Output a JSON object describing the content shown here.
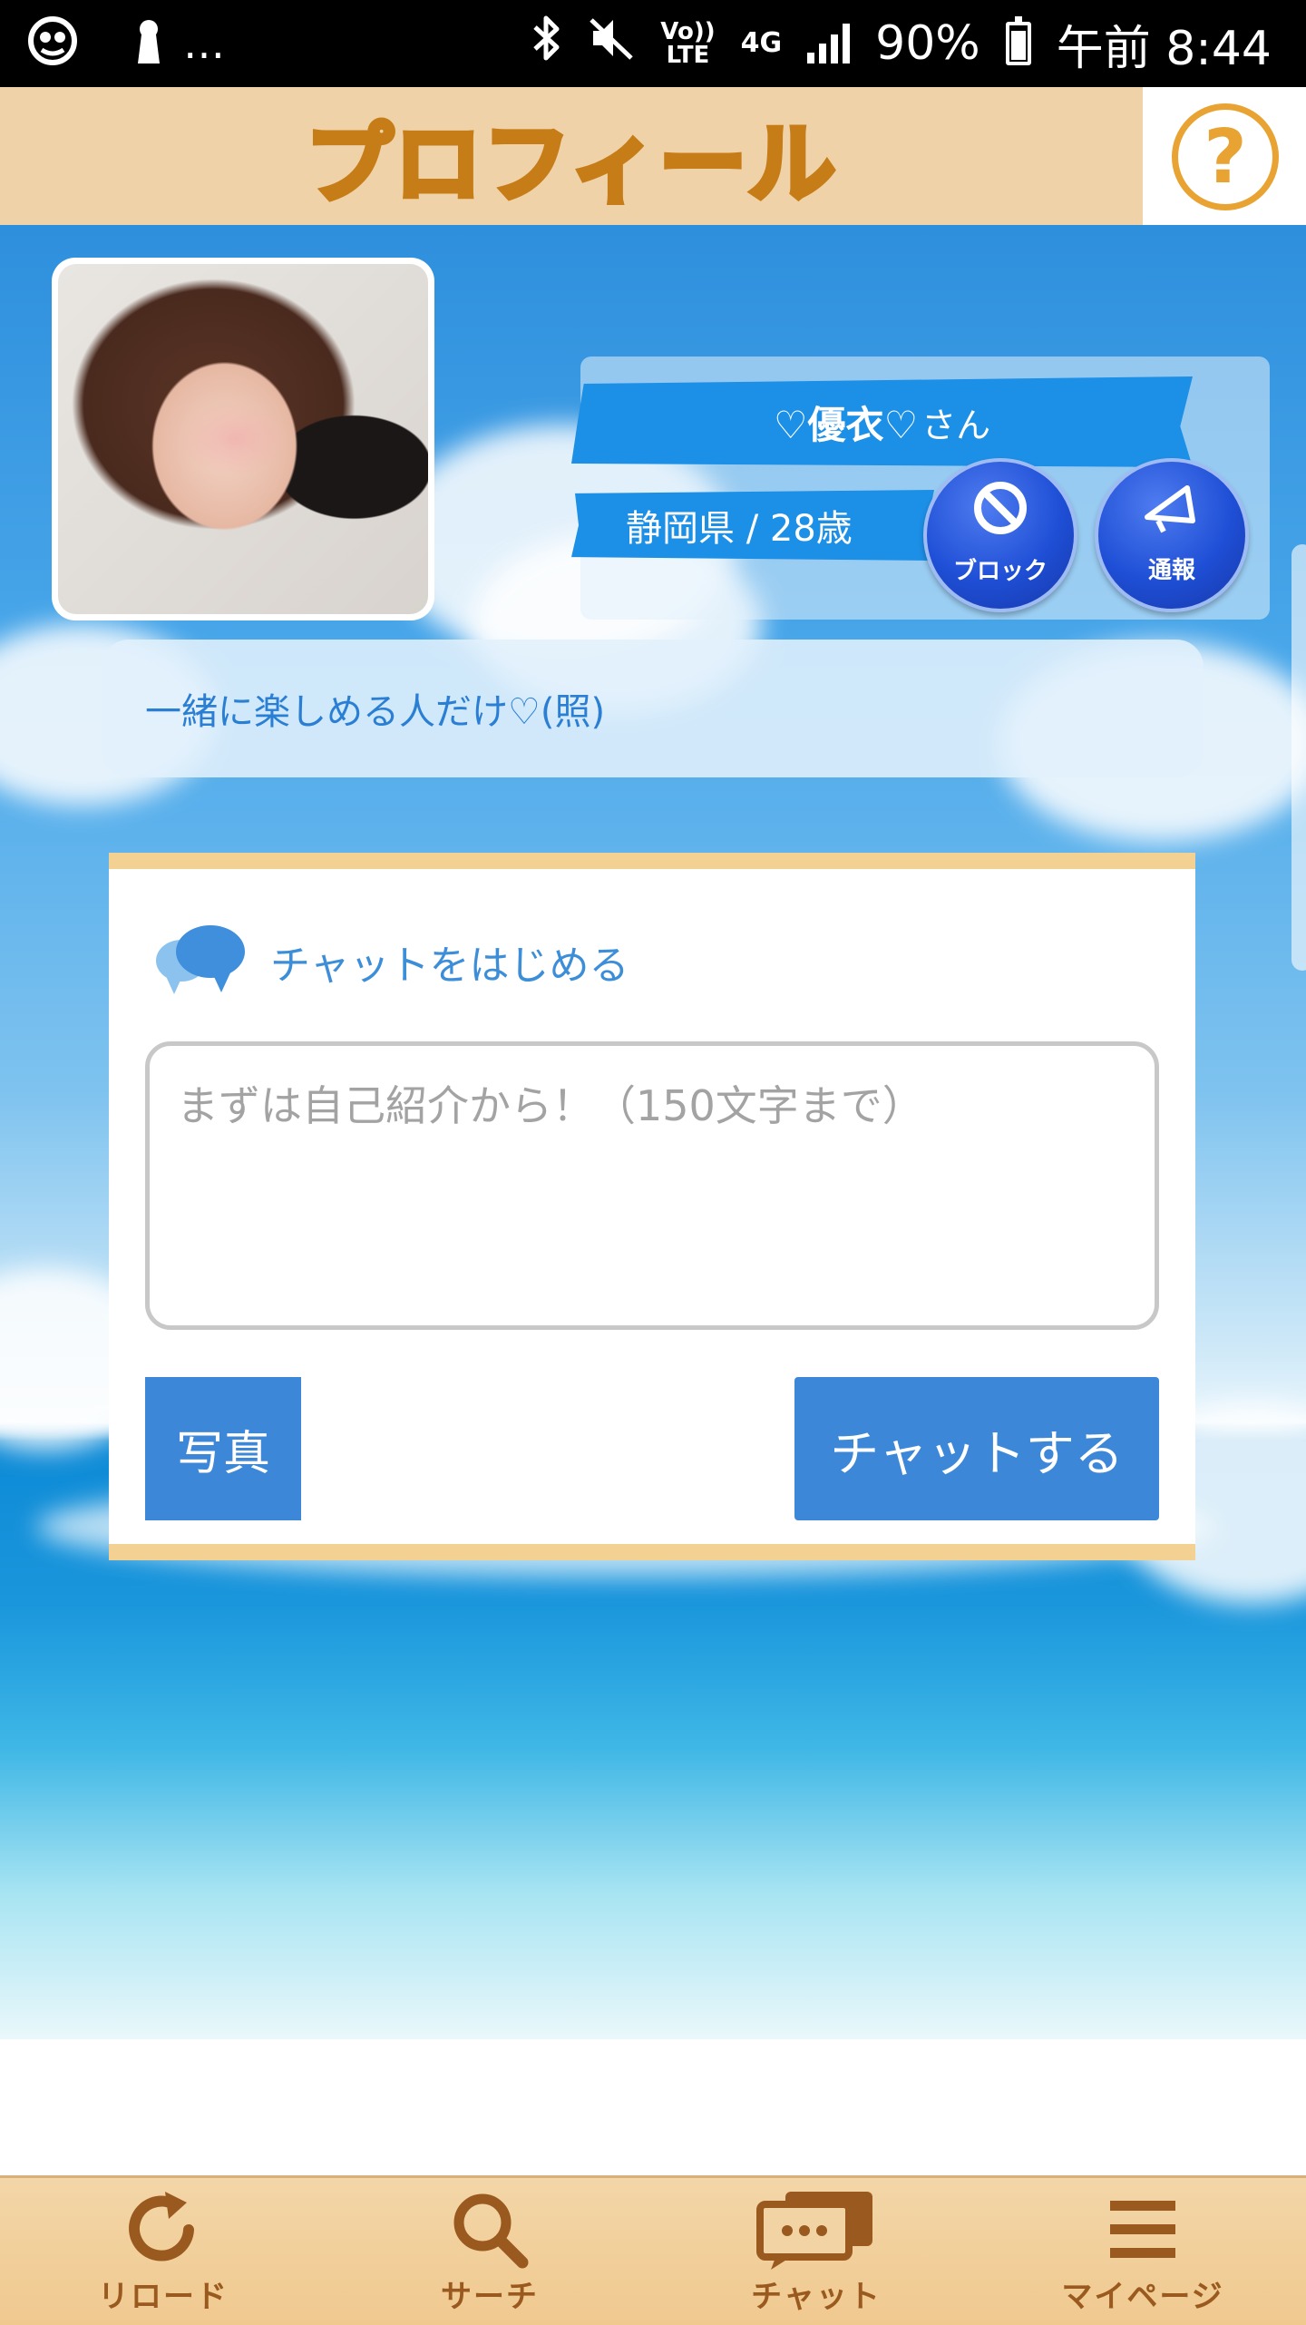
{
  "status_bar": {
    "network": "4G",
    "volte": "Vo))\nLTE",
    "battery": "90%",
    "time": "午前 8:44",
    "more": "…",
    "battery_level": 0.9
  },
  "header": {
    "title": "プロフィール",
    "help_label": "?"
  },
  "profile": {
    "name": "♡優衣♡",
    "honorific": "さん",
    "location_age": "静岡県 / 28歳",
    "block_label": "ブロック",
    "report_label": "通報",
    "bio": "一緒に楽しめる人だけ♡(照)"
  },
  "chat": {
    "heading": "チャットをはじめる",
    "input_placeholder": "まずは自己紹介から！（150文字まで）",
    "input_value": "",
    "photo_button": "写真",
    "send_button": "チャットする"
  },
  "bottom_nav": {
    "items": [
      {
        "label": "リロード",
        "icon": "reload-icon"
      },
      {
        "label": "サーチ",
        "icon": "search-icon"
      },
      {
        "label": "チャット",
        "icon": "chat-icon"
      },
      {
        "label": "マイページ",
        "icon": "menu-icon"
      }
    ]
  },
  "colors": {
    "header_bg": "#f0d2a9",
    "accent_blue": "#3c87d8",
    "title_orange": "#f4b33c",
    "nav_brown": "#9a5a1f",
    "card_border": "#f2d193"
  }
}
